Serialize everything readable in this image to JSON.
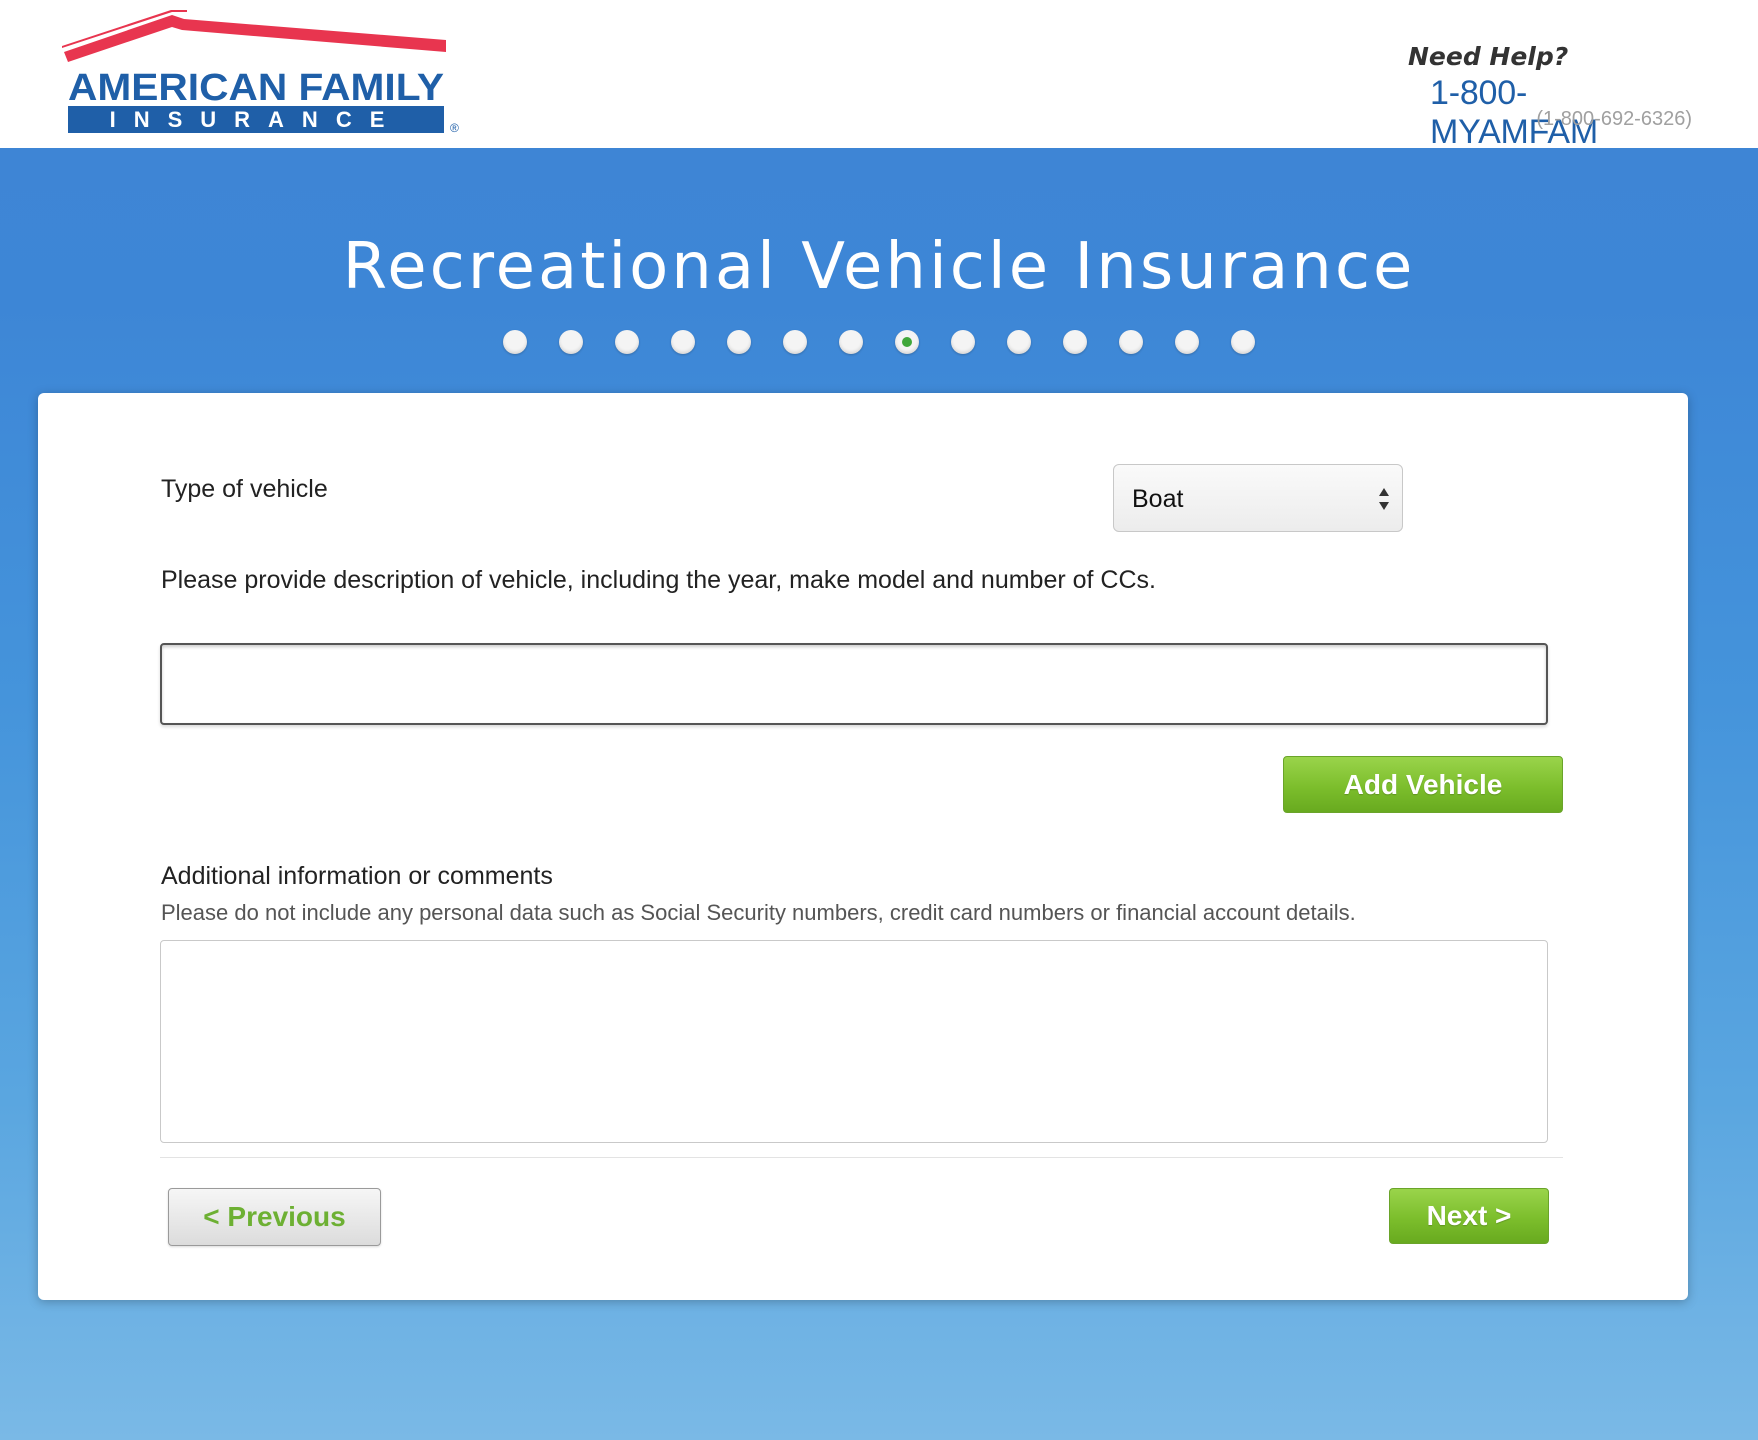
{
  "header": {
    "logo": {
      "line1": "AMERICAN FAMILY",
      "line2": "INSURANCE",
      "registered": "®"
    },
    "help": {
      "title": "Need Help?",
      "phone_label": "1-800-MYAMFAM",
      "phone_digits": "(1-800-692-6326)"
    }
  },
  "main": {
    "title": "Recreational Vehicle Insurance",
    "progress": {
      "total_steps": 14,
      "current_step": 8
    }
  },
  "form": {
    "vehicle_type_label": "Type of vehicle",
    "vehicle_type_value": "Boat",
    "description_label": "Please provide description of vehicle, including the year, make model and number of CCs.",
    "description_value": "",
    "add_vehicle_label": "Add Vehicle",
    "additional_label": "Additional information or comments",
    "additional_note": "Please do not include any personal data such as Social Security numbers, credit card numbers or financial account details.",
    "additional_value": "",
    "previous_label": "< Previous",
    "next_label": "Next >"
  },
  "colors": {
    "brand_blue": "#1f5fa8",
    "brand_red": "#e8354f",
    "accent_green": "#7cbe2c",
    "background_blue": "#3f84d4"
  },
  "icons": {
    "select_arrow": "up-down-arrows-icon"
  }
}
